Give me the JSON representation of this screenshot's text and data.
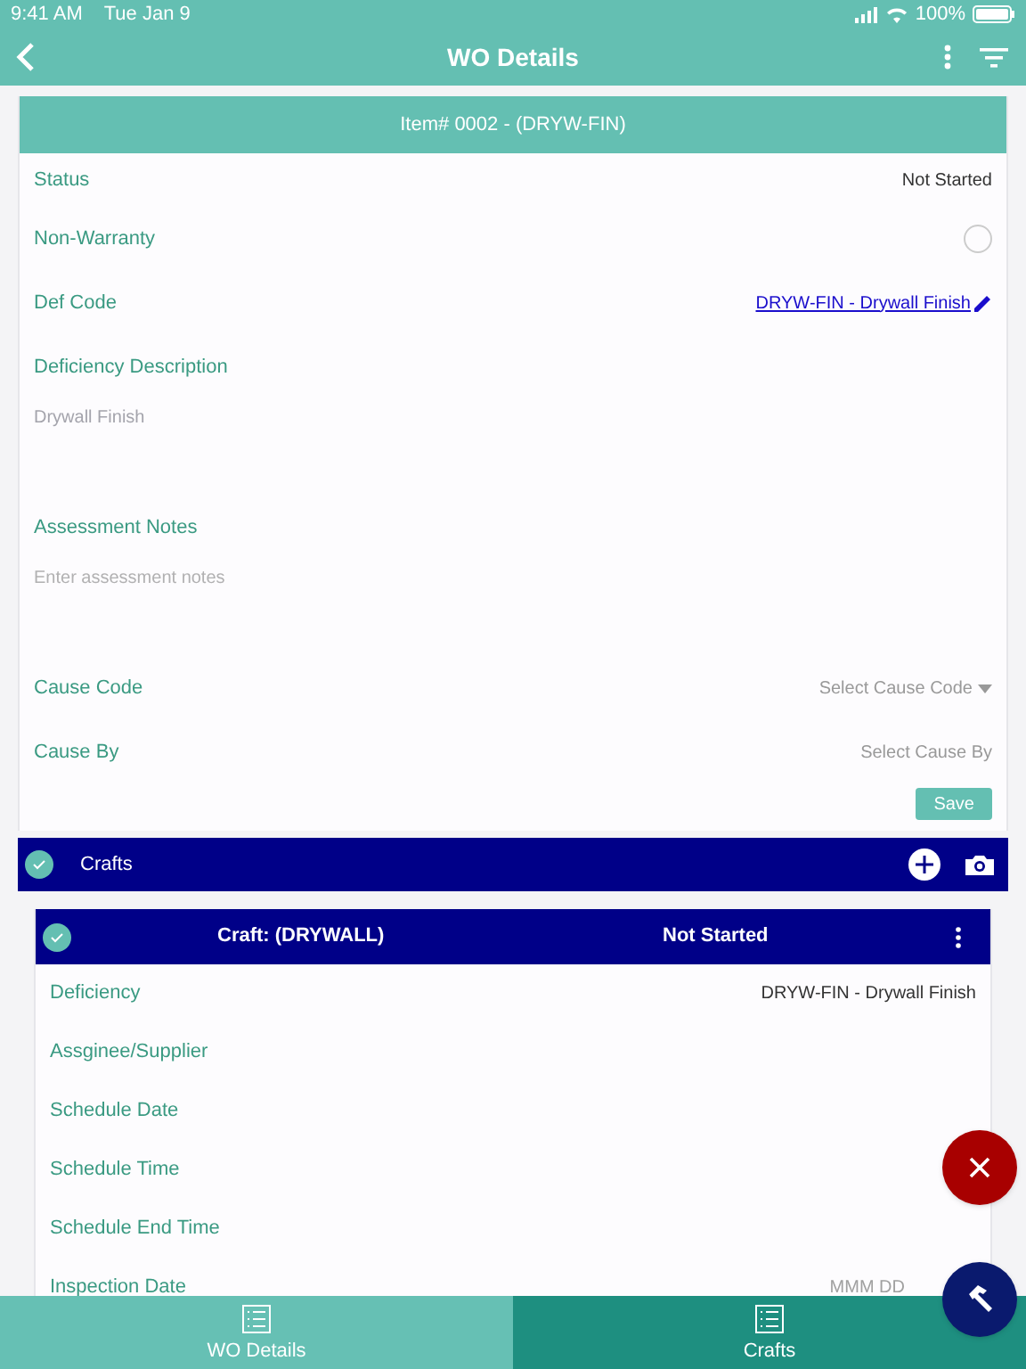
{
  "status_bar": {
    "time": "9:41 AM",
    "date": "Tue Jan 9",
    "battery": "100%"
  },
  "header": {
    "title": "WO Details"
  },
  "item": {
    "title": "Item# 0002 - (DRYW-FIN)",
    "fields": [
      {
        "kind": "value",
        "label": "Status",
        "value": "Not Started"
      },
      {
        "kind": "toggle",
        "label": "Non-Warranty",
        "checked": false
      },
      {
        "kind": "link",
        "label": "Def Code",
        "value": "DRYW-FIN - Drywall Finish"
      },
      {
        "kind": "textarea",
        "label": "Deficiency Description",
        "value": "Drywall Finish",
        "disabled": true
      },
      {
        "kind": "textarea",
        "label": "Assessment Notes",
        "placeholder": "Enter assessment notes"
      },
      {
        "kind": "select",
        "label": "Cause Code",
        "placeholder": "Select Cause Code",
        "dropdown": true
      },
      {
        "kind": "select",
        "label": "Cause By",
        "placeholder": "Select Cause By",
        "dropdown": false
      }
    ],
    "save_label": "Save"
  },
  "crafts": {
    "title": "Crafts",
    "checked": true,
    "cards": [
      {
        "title": "Craft: (DRYWALL)",
        "status": "Not Started",
        "checked": true,
        "fields": [
          {
            "label": "Deficiency",
            "value": "DRYW-FIN - Drywall Finish"
          },
          {
            "label": "Assginee/Supplier"
          },
          {
            "label": "Schedule Date"
          },
          {
            "label": "Schedule Time"
          },
          {
            "label": "Schedule End Time"
          },
          {
            "label": "Inspection Date",
            "placeholder": "MMM DD"
          }
        ]
      }
    ]
  },
  "tabs": [
    {
      "label": "WO Details",
      "selected": true
    },
    {
      "label": "Crafts",
      "selected": false
    }
  ]
}
